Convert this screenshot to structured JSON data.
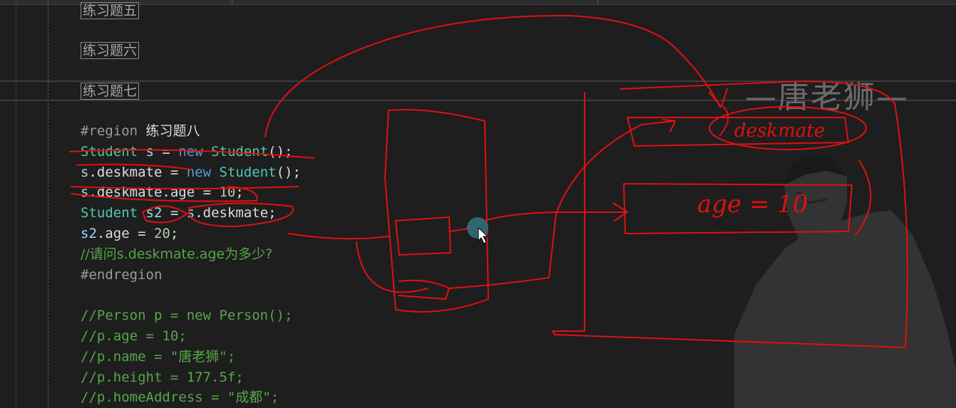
{
  "collapsed_regions": [
    "练习题五",
    "练习题六",
    "练习题七"
  ],
  "code": {
    "region_start": "#region",
    "region_name": "练习题八",
    "l1_type": "Student",
    "l1_var": "s",
    "l1_eq": " = ",
    "l1_new": "new",
    "l1_ctor": "Student",
    "l1_end": "();",
    "l2_var": "s",
    "l2_member": ".deskmate = ",
    "l2_new": "new",
    "l2_ctor": "Student",
    "l2_end": "();",
    "l3_var": "s",
    "l3_member": ".deskmate.age = ",
    "l3_num": "10",
    "l3_end": ";",
    "l4_type": "Student",
    "l4_var": "s2",
    "l4_eq": " = ",
    "l4_var2": "s",
    "l4_end": ".deskmate;",
    "l5_var": "s2",
    "l5_member": ".age = ",
    "l5_num": "20",
    "l5_end": ";",
    "l6_comment": "//请问s.deskmate.age为多少?",
    "region_end": "#endregion",
    "c1": "//Person p = new Person();",
    "c2": "//p.age = 10;",
    "c3": "//p.name = \"唐老狮\";",
    "c4": "//p.height = 177.5f;",
    "c5": "//p.homeAddress = \"成都\";"
  },
  "watermark": "—唐老狮—",
  "annotations": {
    "box1_text": "deskmate",
    "box2_text": "age = 10"
  },
  "colors": {
    "background": "#1e1e1e",
    "keyword": "#569cd6",
    "type": "#4ec9b0",
    "comment": "#57a64a",
    "number": "#b5cea8",
    "annotation_ink": "#e01010"
  }
}
